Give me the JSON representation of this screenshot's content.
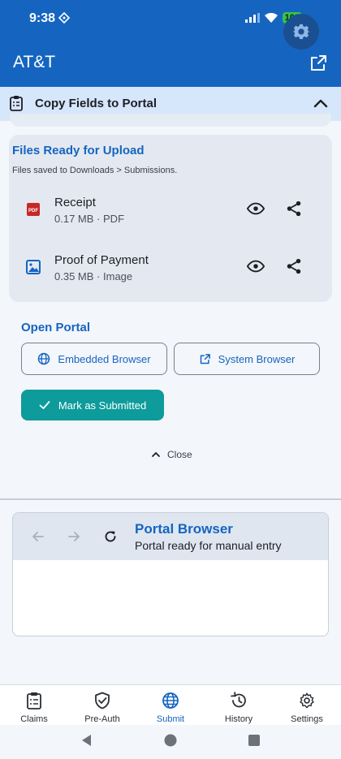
{
  "status_bar": {
    "time": "9:38",
    "battery": "100"
  },
  "app_bar": {
    "title": "AT&T"
  },
  "copy_fields": {
    "label": "Copy Fields to Portal"
  },
  "files_section": {
    "title": "Files Ready for Upload",
    "subtitle": "Files saved to Downloads > Submissions.",
    "files": [
      {
        "name": "Receipt",
        "size": "0.17 MB",
        "type": "PDF",
        "icon": "pdf-icon",
        "separator": "·"
      },
      {
        "name": "Proof of Payment",
        "size": "0.35 MB",
        "type": "Image",
        "icon": "image-icon",
        "separator": "·"
      }
    ]
  },
  "portal_section": {
    "title": "Open Portal",
    "embedded_browser": "Embedded Browser",
    "system_browser": "System Browser",
    "mark_submitted": "Mark as Submitted",
    "close": "Close"
  },
  "portal_browser": {
    "title": "Portal Browser",
    "subtitle": "Portal ready for manual entry"
  },
  "bottom_nav": {
    "items": [
      {
        "label": "Claims",
        "icon": "clipboard-icon",
        "active": false
      },
      {
        "label": "Pre-Auth",
        "icon": "shield-check-icon",
        "active": false
      },
      {
        "label": "Submit",
        "icon": "globe-icon",
        "active": true
      },
      {
        "label": "History",
        "icon": "history-icon",
        "active": false
      },
      {
        "label": "Settings",
        "icon": "gear-icon",
        "active": false
      }
    ]
  },
  "colors": {
    "primary": "#1565c0",
    "accent": "#0e9b9b",
    "header_tint": "#d6e6fb",
    "pdf_red": "#c62828"
  }
}
